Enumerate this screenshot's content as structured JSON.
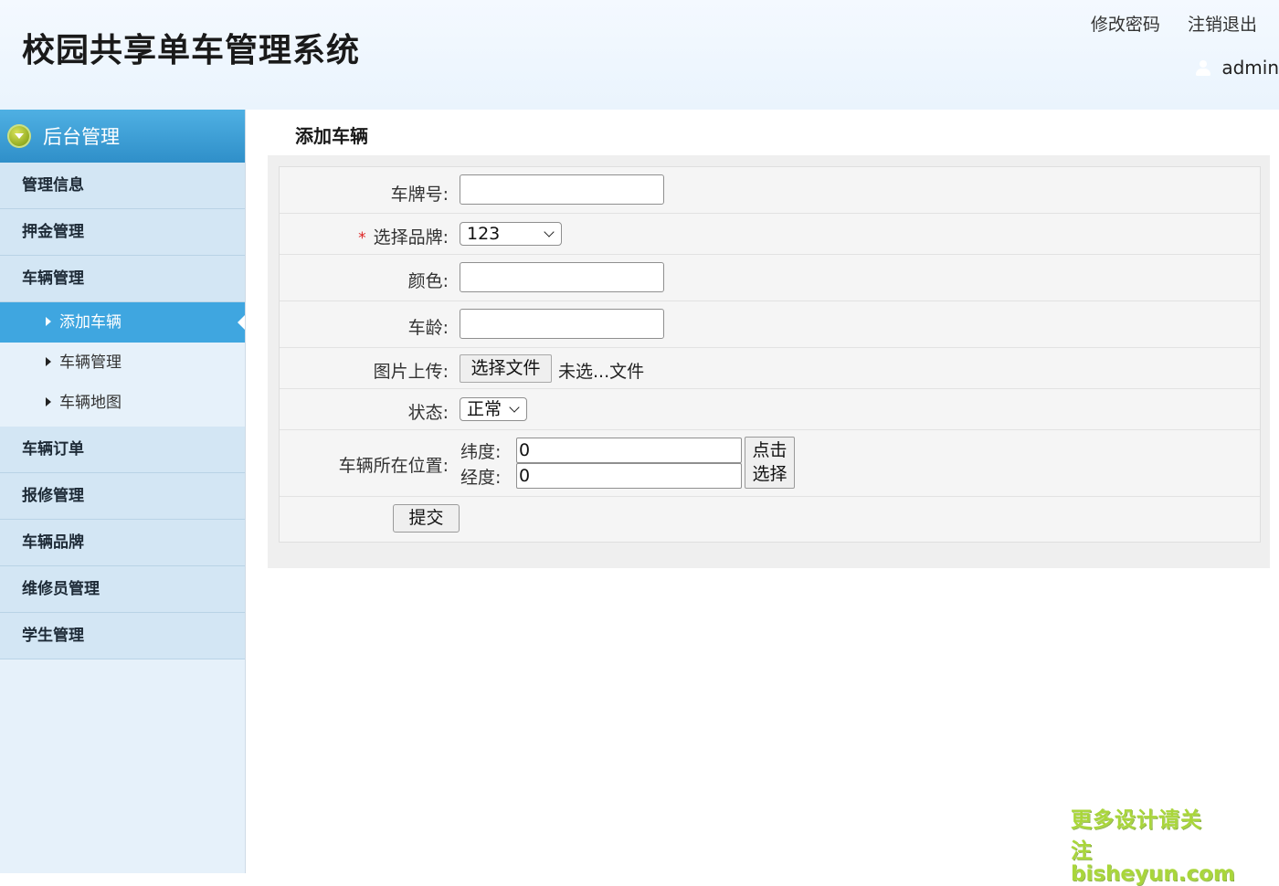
{
  "header": {
    "title": "校园共享单车管理系统",
    "change_password": "修改密码",
    "logout": "注销退出",
    "username": "admin"
  },
  "sidebar": {
    "header": "后台管理",
    "items": [
      {
        "label": "管理信息"
      },
      {
        "label": "押金管理"
      },
      {
        "label": "车辆管理",
        "children": [
          {
            "label": "添加车辆",
            "active": true
          },
          {
            "label": "车辆管理"
          },
          {
            "label": "车辆地图"
          }
        ]
      },
      {
        "label": "车辆订单"
      },
      {
        "label": "报修管理"
      },
      {
        "label": "车辆品牌"
      },
      {
        "label": "维修员管理"
      },
      {
        "label": "学生管理"
      }
    ]
  },
  "page": {
    "title": "添加车辆"
  },
  "form": {
    "plate_label": "车牌号:",
    "plate_value": "",
    "brand_required_mark": "*",
    "brand_label": "选择品牌:",
    "brand_value": "123",
    "color_label": "颜色:",
    "color_value": "",
    "age_label": "车龄:",
    "age_value": "",
    "image_label": "图片上传:",
    "file_button": "选择文件",
    "file_status": "未选...文件",
    "status_label": "状态:",
    "status_value": "正常",
    "location_label": "车辆所在位置:",
    "lat_label": "纬度:",
    "lat_value": "0",
    "lng_label": "经度:",
    "lng_value": "0",
    "pick_button_line1": "点击",
    "pick_button_line2": "选择",
    "submit": "提交"
  },
  "watermark": {
    "line1": "更多设计请关注",
    "line2": "bisheyun.com"
  }
}
